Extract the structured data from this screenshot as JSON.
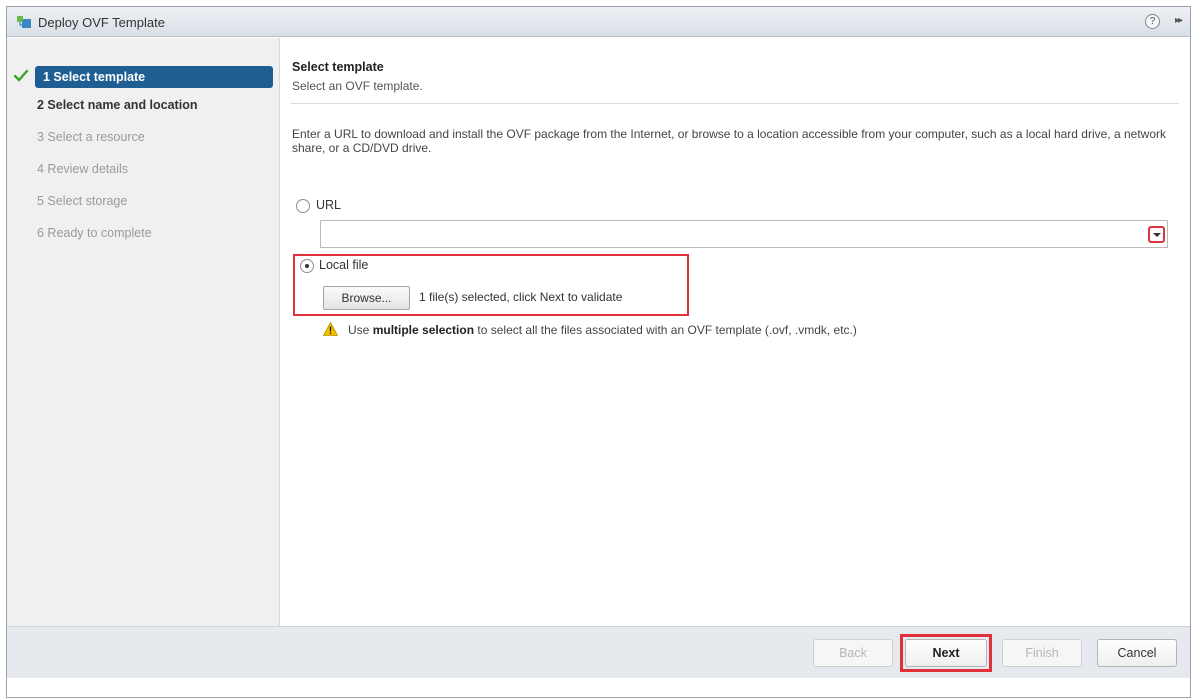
{
  "window": {
    "title": "Deploy OVF Template",
    "help_glyph": "?",
    "expand_glyph": "▸▸"
  },
  "steps": [
    {
      "label": "1  Select template",
      "state": "completed-active"
    },
    {
      "label": "2  Select name and location",
      "state": "next"
    },
    {
      "label": "3  Select a resource",
      "state": "disabled"
    },
    {
      "label": "4  Review details",
      "state": "disabled"
    },
    {
      "label": "5  Select storage",
      "state": "disabled"
    },
    {
      "label": "6  Ready to complete",
      "state": "disabled"
    }
  ],
  "main": {
    "section_title": "Select template",
    "section_subtitle": "Select an OVF template.",
    "description": "Enter a URL to download and install the OVF package from the Internet, or browse to a location accessible from your computer, such as a local hard drive, a network share, or a CD/DVD drive.",
    "url_option_label": "URL",
    "url_value": "",
    "local_file_option_label": "Local file",
    "browse_label": "Browse...",
    "file_status": "1 file(s) selected, click Next to validate",
    "warning_prefix": "Use ",
    "warning_bold": "multiple selection",
    "warning_suffix": " to select all the files associated with an OVF template (.ovf, .vmdk, etc.)",
    "selected_option": "Local file"
  },
  "footer": {
    "back_label": "Back",
    "next_label": "Next",
    "finish_label": "Finish",
    "cancel_label": "Cancel"
  },
  "colors": {
    "active_step": "#1f5e93",
    "highlight": "#e0313a",
    "check": "#3aa52c",
    "warning": "#f2c100"
  }
}
